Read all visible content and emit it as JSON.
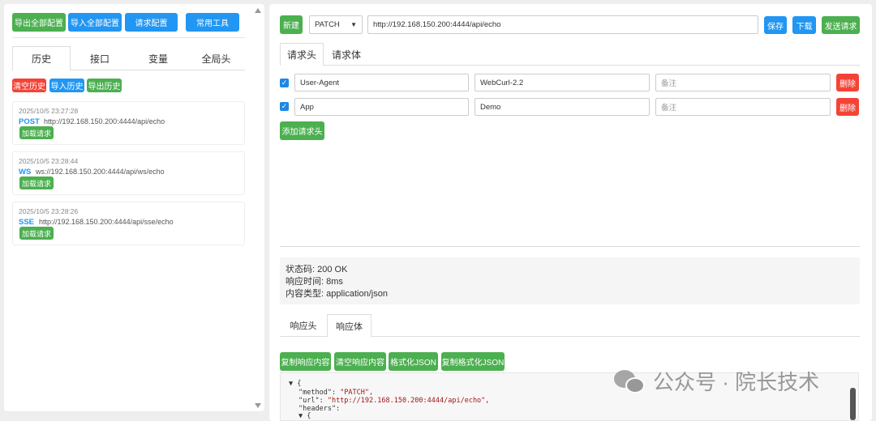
{
  "left": {
    "toolbar": [
      "导出全部配置",
      "导入全部配置",
      "请求配置",
      "常用工具"
    ],
    "tabs": [
      "历史",
      "接口",
      "变量",
      "全局头"
    ],
    "history_actions": [
      "清空历史",
      "导入历史",
      "导出历史"
    ],
    "history": [
      {
        "time": "2025/10/5 23:27:28",
        "method": "POST",
        "url": "http://192.168.150.200:4444/api/echo",
        "load": "加载请求"
      },
      {
        "time": "2025/10/5 23:28:44",
        "method": "WS",
        "url": "ws://192.168.150.200:4444/api/ws/echo",
        "load": "加载请求"
      },
      {
        "time": "2025/10/5 23:28:26",
        "method": "SSE",
        "url": "http://192.168.150.200:4444/api/sse/echo",
        "load": "加载请求"
      }
    ]
  },
  "request": {
    "new": "新建",
    "method": "PATCH",
    "url": "http://192.168.150.200:4444/api/echo",
    "save": "保存",
    "download": "下载",
    "send": "发送请求",
    "tabs": [
      "请求头",
      "请求体"
    ],
    "headers": [
      {
        "checked": true,
        "key": "User-Agent",
        "value": "WebCurl-2.2",
        "note_placeholder": "备注",
        "delete": "删除"
      },
      {
        "checked": true,
        "key": "App",
        "value": "Demo",
        "note_placeholder": "备注",
        "delete": "删除"
      }
    ],
    "add_header": "添加请求头"
  },
  "response": {
    "status": "状态码: 200 OK",
    "time": "响应时间: 8ms",
    "content_type": "内容类型: application/json",
    "tabs": [
      "响应头",
      "响应体"
    ],
    "actions": [
      "复制响应内容",
      "清空响应内容",
      "格式化JSON",
      "复制格式化JSON"
    ],
    "body_lines": [
      {
        "k": "",
        "v": "▼ {"
      },
      {
        "k": "\"method\": ",
        "v": "\"PATCH\","
      },
      {
        "k": "\"url\": ",
        "v": "\"http://192.168.150.200:4444/api/echo\","
      },
      {
        "k": "\"headers\":",
        "v": ""
      },
      {
        "k": "",
        "v": "▼ {"
      }
    ]
  },
  "watermark": "公众号 · 院长技术",
  "colors": {
    "green": "#4caf50",
    "blue": "#2196f3",
    "red": "#f44336"
  }
}
